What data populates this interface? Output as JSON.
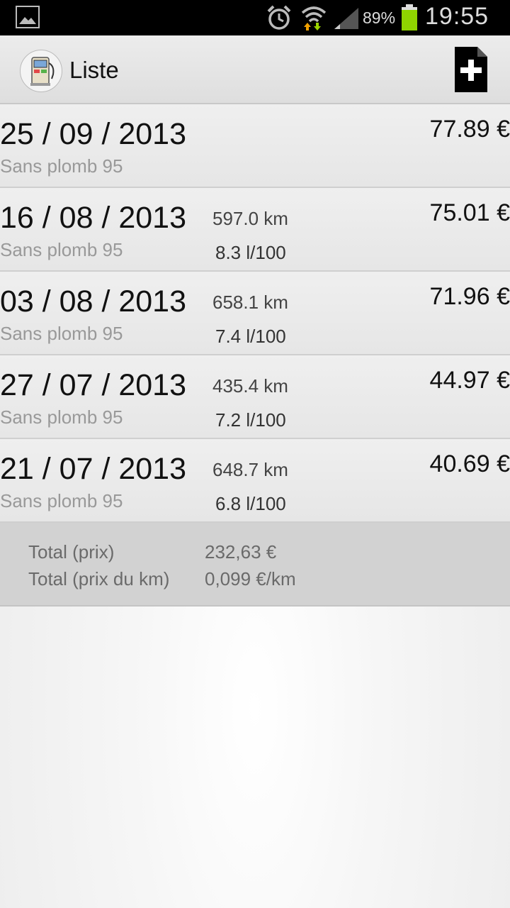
{
  "status_bar": {
    "battery_percent": "89%",
    "time": "19:55",
    "icons": [
      "gallery-icon",
      "alarm-icon",
      "wifi-icon",
      "signal-icon",
      "battery-icon"
    ],
    "battery_color": "#8fd400"
  },
  "header": {
    "title": "Liste",
    "add_icon": "add-document-icon"
  },
  "entries": [
    {
      "date": "25 / 09 / 2013",
      "fuel": "Sans plomb 95",
      "km": "",
      "consumption": "",
      "price": "77.89 €"
    },
    {
      "date": "16 / 08 / 2013",
      "fuel": "Sans plomb 95",
      "km": "597.0 km",
      "consumption": "8.3 l/100",
      "price": "75.01 €"
    },
    {
      "date": "03 / 08 / 2013",
      "fuel": "Sans plomb 95",
      "km": "658.1 km",
      "consumption": "7.4 l/100",
      "price": "71.96 €"
    },
    {
      "date": "27 / 07 / 2013",
      "fuel": "Sans plomb 95",
      "km": "435.4 km",
      "consumption": "7.2 l/100",
      "price": "44.97 €"
    },
    {
      "date": "21 / 07 / 2013",
      "fuel": "Sans plomb 95",
      "km": "648.7 km",
      "consumption": "6.8 l/100",
      "price": "40.69 €"
    }
  ],
  "totals": {
    "price_label": "Total (prix)",
    "price_value": "232,63 €",
    "per_km_label": "Total (prix du km)",
    "per_km_value": "0,099 €/km"
  }
}
